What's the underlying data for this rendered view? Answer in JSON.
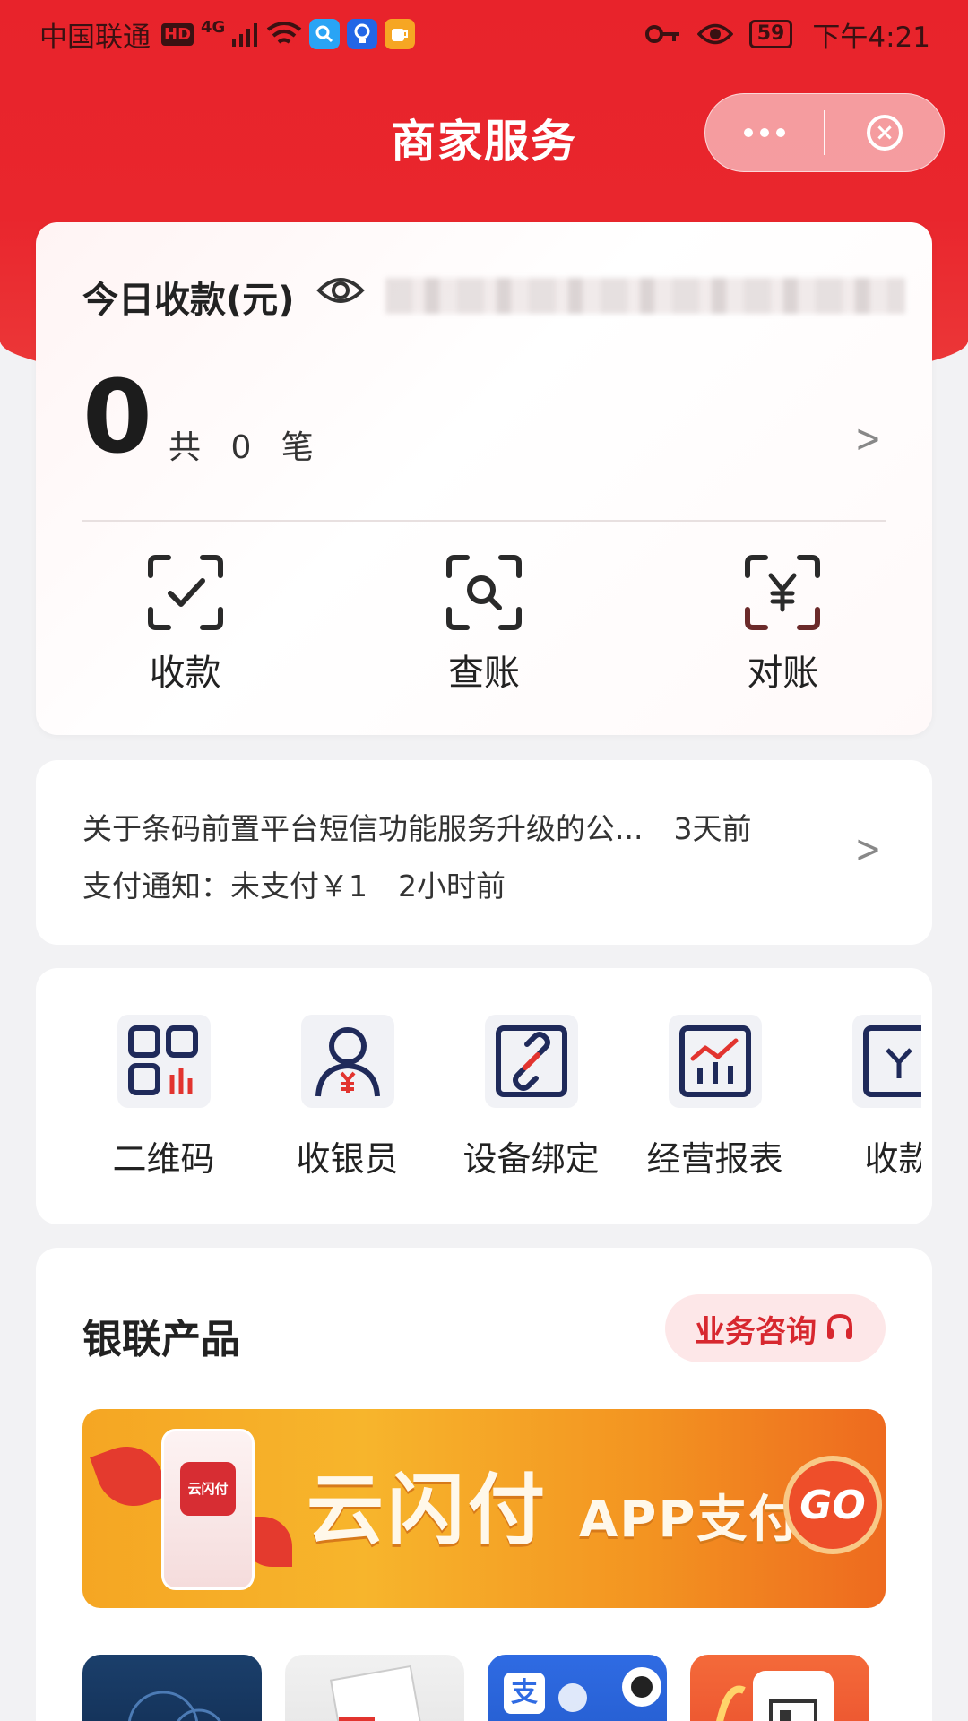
{
  "status_bar": {
    "carrier": "中国联通",
    "hd": "HD",
    "network": "4G",
    "battery": "59",
    "time": "下午4:21"
  },
  "nav": {
    "title": "商家服务"
  },
  "revenue": {
    "label": "今日收款(元)",
    "amount": "0",
    "count_text": "共 0 笔",
    "actions": [
      {
        "label": "收款",
        "icon": "checkmark-scan-icon"
      },
      {
        "label": "查账",
        "icon": "search-scan-icon"
      },
      {
        "label": "对账",
        "icon": "yuan-scan-icon"
      }
    ]
  },
  "notices": [
    {
      "text": "关于条码前置平台短信功能服务升级的公...",
      "time": "3天前"
    },
    {
      "text": "支付通知：未支付￥1",
      "time": "2小时前"
    }
  ],
  "tools": [
    {
      "label": "二维码",
      "icon": "qrcode-icon"
    },
    {
      "label": "收银员",
      "icon": "cashier-icon"
    },
    {
      "label": "设备绑定",
      "icon": "device-link-icon"
    },
    {
      "label": "经营报表",
      "icon": "report-chart-icon"
    },
    {
      "label": "收款",
      "icon": "receipt-icon"
    }
  ],
  "products": {
    "title": "银联产品",
    "consult_label": "业务咨询",
    "banner": {
      "main": "云闪付",
      "sub": "APP支付",
      "go": "GO",
      "phone_logo": "云闪付"
    },
    "thumbs_alipay_glyph": "支"
  },
  "colors": {
    "brand_red": "#e8232b",
    "icon_navy": "#1f2a5a",
    "icon_red": "#e2342f"
  }
}
